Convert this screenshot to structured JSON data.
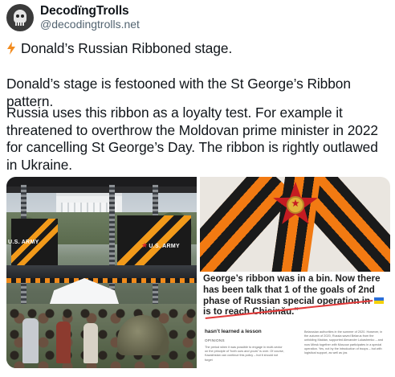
{
  "author": {
    "display_name": "DecodïngTrolls",
    "handle": "@decodingtrolls.net",
    "avatar_icon": "skull-avatar-icon"
  },
  "post": {
    "title_icon": "lightning-bolt-icon",
    "title": "Donald’s Russian Ribboned stage.",
    "paragraph_1": "Donald’s stage is festooned with the St George’s Ribbon pattern.",
    "paragraph_2": "Russia uses this ribbon as a loyalty test. For example it threatened to overthrow the Moldovan prime minister in 2022 for cancelling St George’s Day. The ribbon is rightly outlawed in Ukraine."
  },
  "media": {
    "stage_photo": {
      "banner_left": "U.S. ARMY",
      "banner_right": "U.S. ARMY"
    },
    "ribbon_photo": {},
    "article_screenshot": {
      "quote_part_1": "George’s ribbon was in a bin. Now there has been talk that 1 of the goals of 2nd phase of Russian special operation in",
      "quote_part_2": "is to reach Chisinău.\"",
      "heading": "hasn’t learned a lesson",
      "section": "OPINIONS",
      "left_column": "The period when it was possible to engage in multi-vector on the principle of “both ours and yours” is over. Of course, Kazakhstan can continue this policy – but it should not forget",
      "right_column": "Belarusian authorities in the summer of 2020. However, in the autumn of 2020, Russia saved Belarus from the unfolding Maidan, supported Alexander Lukashenko – and now Minsk together with Moscow participates in a special operation. Yes, not by the introduction of troops – but with logistical support, as well as (as"
    }
  },
  "colors": {
    "ribbon_orange": "#f27a12",
    "ribbon_black": "#1a1a1a",
    "handle_gray": "#536471",
    "strike_red": "#e23a3a"
  }
}
